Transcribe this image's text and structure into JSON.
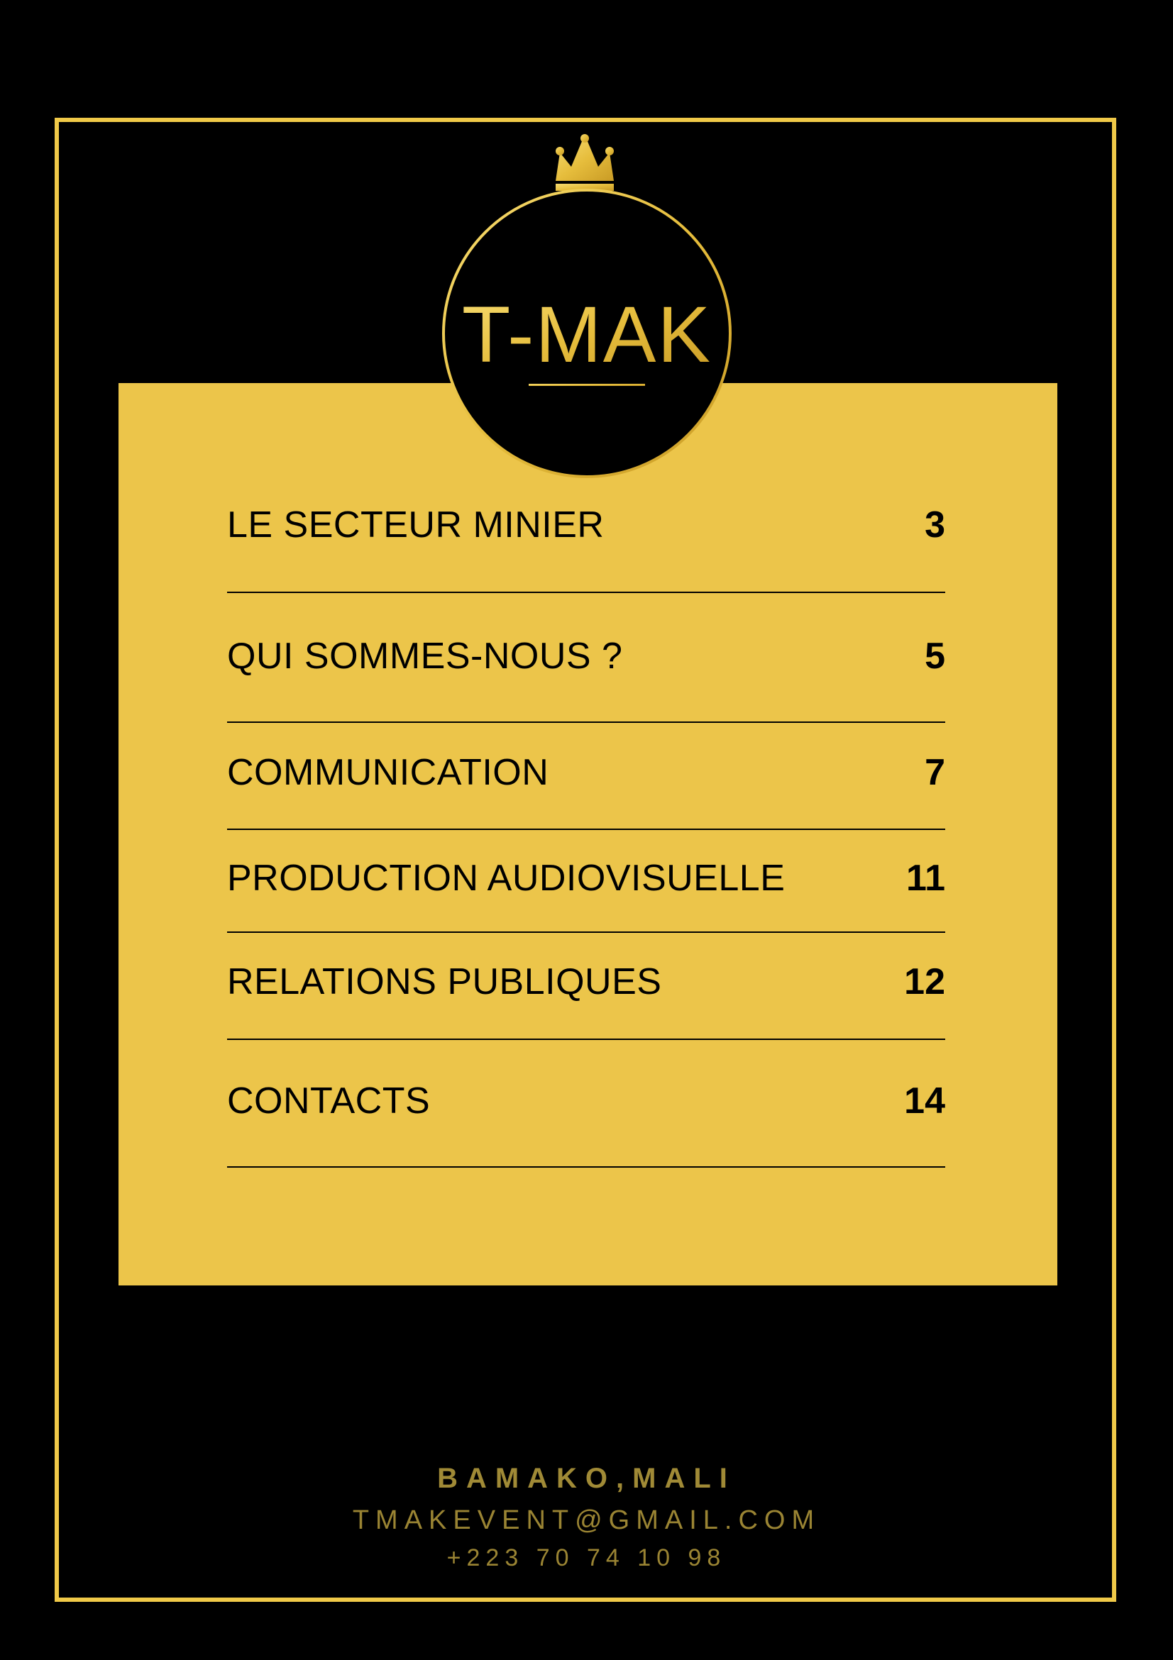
{
  "logo": {
    "text": "T-MAK",
    "icon": "crown-icon",
    "gold": "#f0c948",
    "background": "#000000"
  },
  "toc": {
    "items": [
      {
        "label": "LE SECTEUR MINIER",
        "page": "3"
      },
      {
        "label": "QUI SOMMES-NOUS ?",
        "page": "5"
      },
      {
        "label": "COMMUNICATION",
        "page": "7"
      },
      {
        "label": "PRODUCTION AUDIOVISUELLE",
        "page": "11"
      },
      {
        "label": "RELATIONS PUBLIQUES",
        "page": "12"
      },
      {
        "label": "CONTACTS",
        "page": "14"
      }
    ]
  },
  "footer": {
    "city": "BAMAKO,MALI",
    "email": "TMAKEVENT@GMAIL.COM",
    "phone": "+223 70 74 10 98"
  },
  "colors": {
    "accent": "#ecc54a",
    "frame": "#f0c948",
    "footer_text": "#9a8433",
    "background": "#000000"
  }
}
